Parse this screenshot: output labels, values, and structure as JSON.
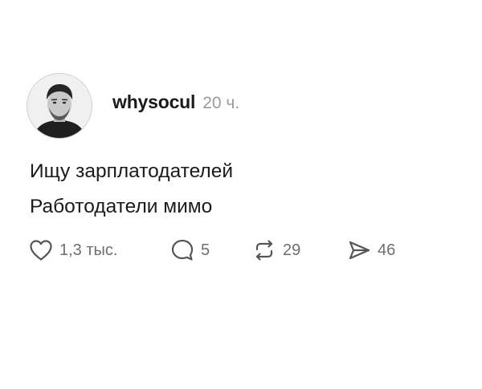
{
  "post": {
    "author": {
      "username": "whysocul",
      "avatar_icon": "person-avatar"
    },
    "timestamp": "20 ч.",
    "lines": [
      "Ищу зарплатодателей",
      "Работодатели мимо"
    ],
    "actions": {
      "likes": {
        "icon": "heart-icon",
        "count": "1,3 тыс."
      },
      "comments": {
        "icon": "comment-bubble-icon",
        "count": "5"
      },
      "reposts": {
        "icon": "repost-icon",
        "count": "29"
      },
      "shares": {
        "icon": "send-icon",
        "count": "46"
      }
    }
  },
  "colors": {
    "text": "#1a1a1a",
    "muted": "#9a9a9a",
    "action_count": "#6f6f6f",
    "background": "#ffffff"
  }
}
